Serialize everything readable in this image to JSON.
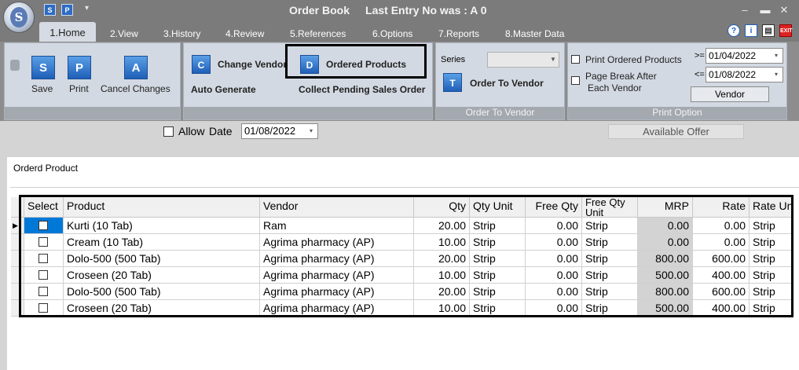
{
  "app": {
    "logo_letter": "S",
    "quick_access": [
      "S",
      "P"
    ],
    "title": "Order Book",
    "last_entry": "Last Entry No was : A 0"
  },
  "tabs": [
    {
      "label": "1.Home",
      "active": true
    },
    {
      "label": "2.View"
    },
    {
      "label": "3.History"
    },
    {
      "label": "4.Review"
    },
    {
      "label": "5.References"
    },
    {
      "label": "6.Options"
    },
    {
      "label": "7.Reports"
    },
    {
      "label": "8.Master Data"
    }
  ],
  "ribbon": {
    "edit_group": {
      "save_label": "Save",
      "save_icon_letter": "S",
      "print_label": "Print",
      "print_icon_letter": "P",
      "cancel_label": "Cancel Changes",
      "cancel_icon_letter": "A"
    },
    "vendor_group": {
      "change_vendor_label": "Change Vendor",
      "change_vendor_icon_letter": "C",
      "ordered_products_label": "Ordered Products",
      "ordered_products_icon_letter": "D",
      "auto_generate_label": "Auto Generate",
      "collect_pending_label": "Collect Pending Sales Order"
    },
    "order_to_vendor_group": {
      "series_label": "Series",
      "series_value": "",
      "order_to_vendor_label": "Order To Vendor",
      "order_icon_letter": "T",
      "group_label": "Order To Vendor"
    },
    "print_option_group": {
      "print_ordered_products_label": "Print Ordered Products",
      "page_break_label_1": "Page Break After",
      "page_break_label_2": "Each Vendor",
      "from_op": ">=",
      "from_date": "01/04/2022",
      "to_op": "<=",
      "to_date": "01/08/2022",
      "vendor_button_label": "Vendor",
      "group_label": "Print Option"
    }
  },
  "filter": {
    "allow_label": "Allow",
    "date_label": "Date",
    "date_value": "01/08/2022",
    "available_offer_label": "Available Offer"
  },
  "panel_title": "Orderd Product",
  "grid": {
    "columns": [
      "Select",
      "Product",
      "Vendor",
      "Qty",
      "Qty Unit",
      "Free Qty",
      "Free Qty Unit",
      "MRP",
      "Rate",
      "Rate Un"
    ],
    "rows": [
      [
        "",
        "Kurti (10 Tab)",
        "Ram",
        "20.00",
        "Strip",
        "0.00",
        "Strip",
        "0.00",
        "0.00",
        "Strip"
      ],
      [
        "",
        "Cream (10 Tab)",
        "Agrima pharmacy (AP)",
        "10.00",
        "Strip",
        "0.00",
        "Strip",
        "0.00",
        "0.00",
        "Strip"
      ],
      [
        "",
        "Dolo-500 (500 Tab)",
        "Agrima pharmacy (AP)",
        "20.00",
        "Strip",
        "0.00",
        "Strip",
        "800.00",
        "600.00",
        "Strip"
      ],
      [
        "",
        "Croseen (20 Tab)",
        "Agrima pharmacy (AP)",
        "10.00",
        "Strip",
        "0.00",
        "Strip",
        "500.00",
        "400.00",
        "Strip"
      ],
      [
        "",
        "Dolo-500 (500 Tab)",
        "Agrima pharmacy (AP)",
        "20.00",
        "Strip",
        "0.00",
        "Strip",
        "800.00",
        "600.00",
        "Strip"
      ],
      [
        "",
        "Croseen (20 Tab)",
        "Agrima pharmacy (AP)",
        "10.00",
        "Strip",
        "0.00",
        "Strip",
        "500.00",
        "400.00",
        "Strip"
      ]
    ]
  },
  "colors": {
    "accent": "#0078d7",
    "ribbon_bg": "#d3d9e2",
    "titlebar": "#7b7b7b"
  }
}
